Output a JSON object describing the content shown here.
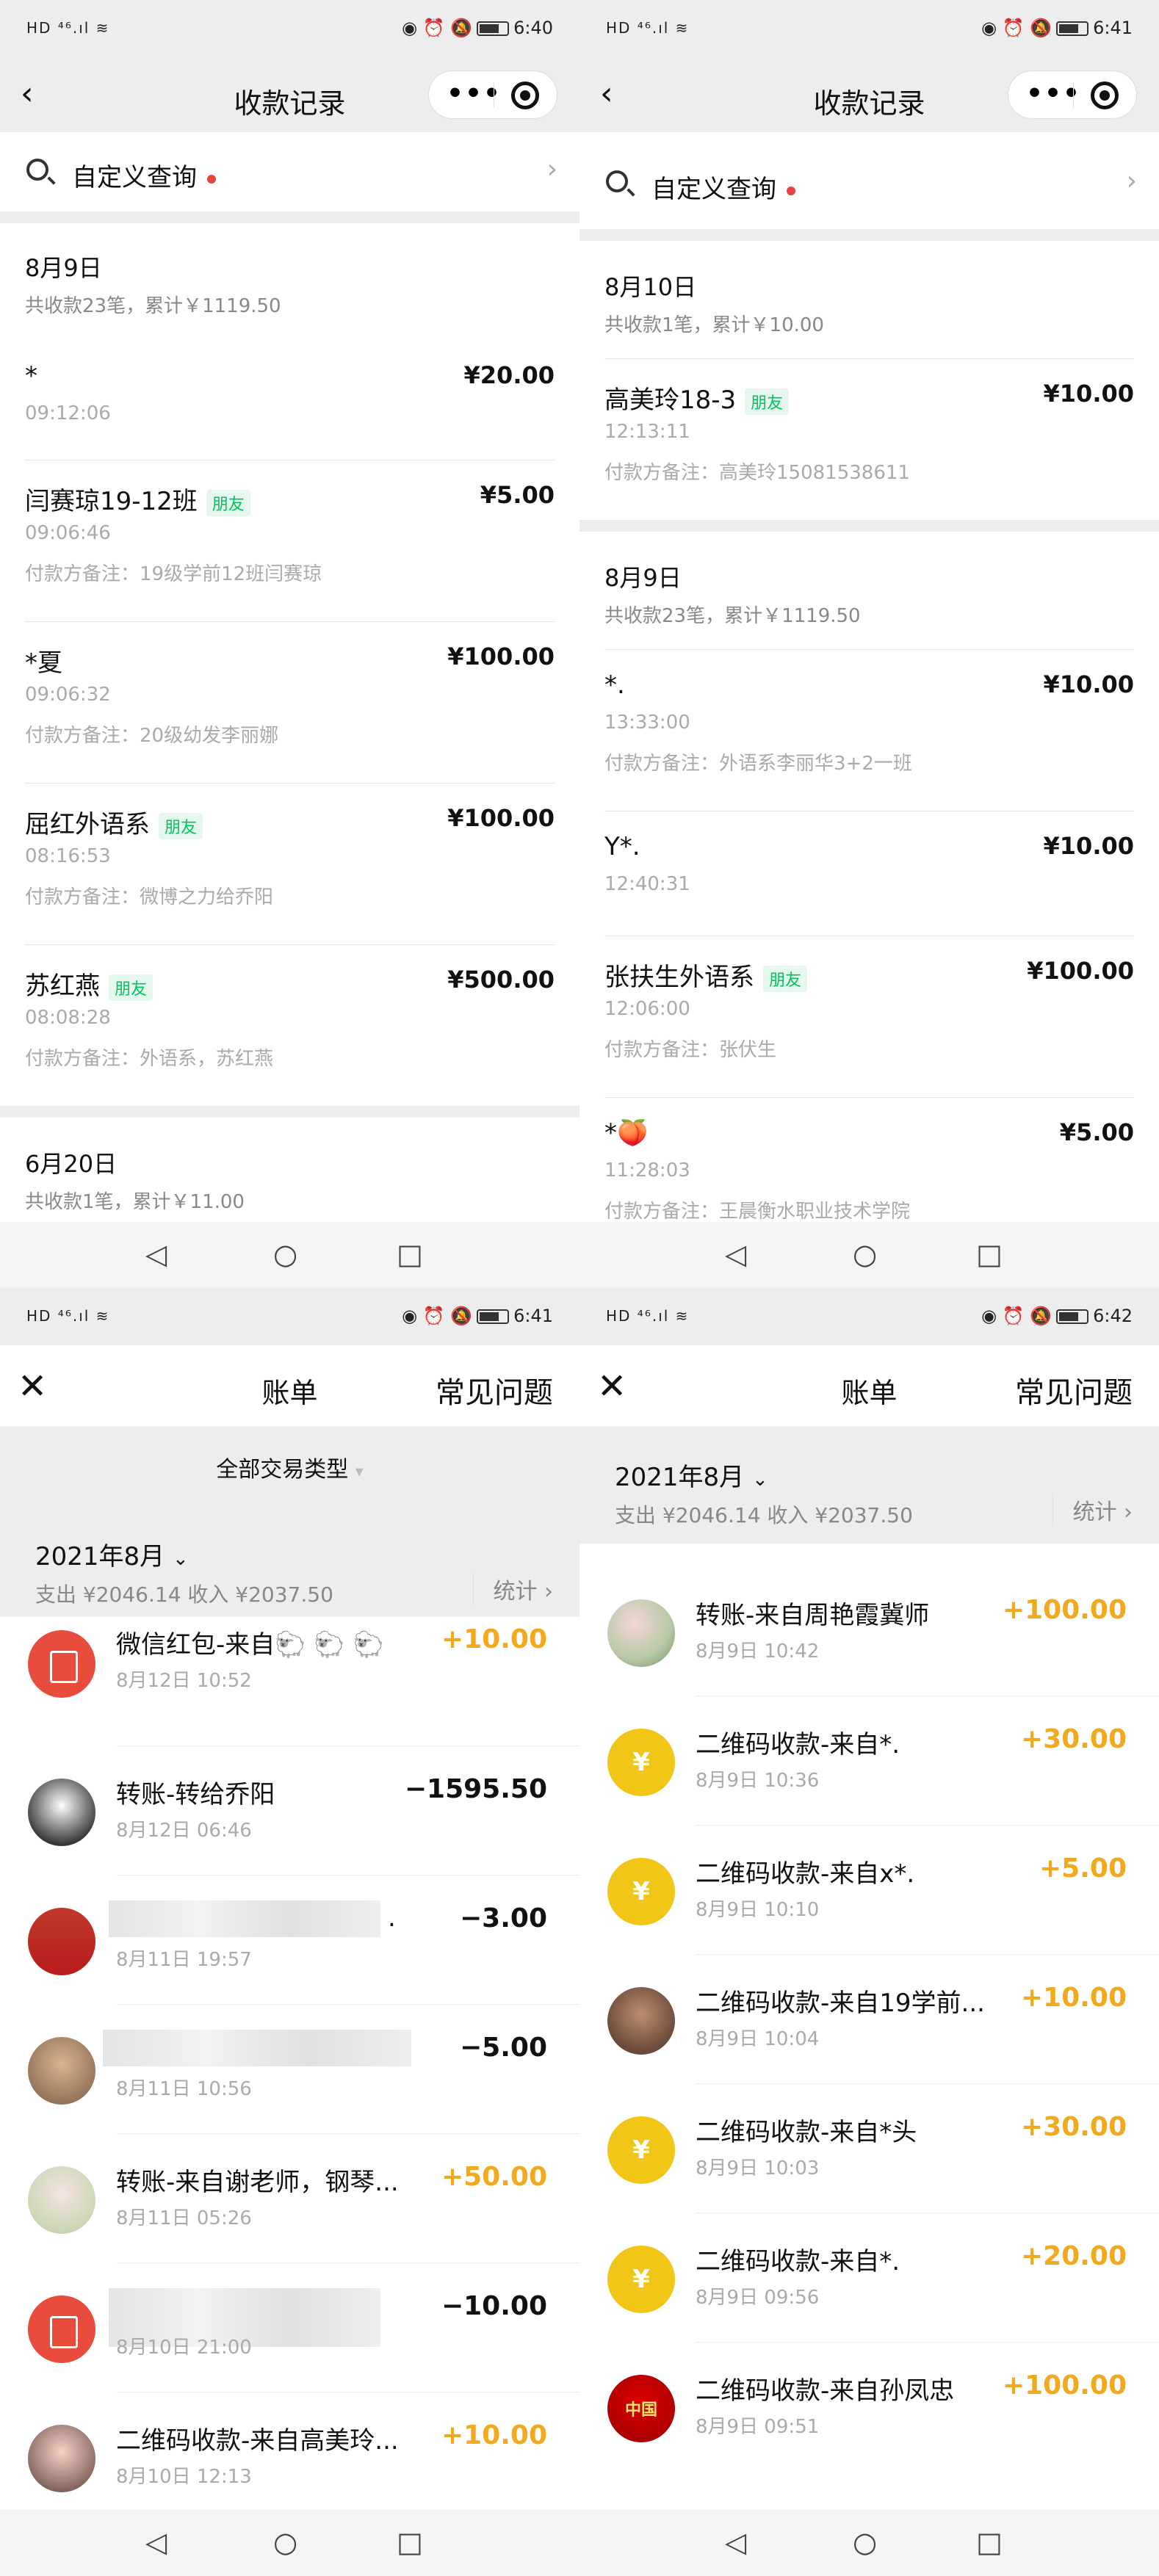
{
  "p1": {
    "status": {
      "left": "HD ⁴⁶.ıl ≋",
      "right_icons": "◉ ⏰ 🔕",
      "time": "6:40"
    },
    "title": "收款记录",
    "search": {
      "label": "自定义查询"
    },
    "day1": {
      "title": "8月9日",
      "summary": "共收款23笔，累计￥1119.50"
    },
    "records": [
      {
        "name": "*",
        "amount": "¥20.00",
        "time": "09:12:06",
        "note": ""
      },
      {
        "name": "闫赛琼19-12班",
        "badge": "朋友",
        "amount": "¥5.00",
        "time": "09:06:46",
        "note": "付款方备注：19级学前12班闫赛琼"
      },
      {
        "name": "*夏",
        "amount": "¥100.00",
        "time": "09:06:32",
        "note": "付款方备注：20级幼发李丽娜"
      },
      {
        "name": "屈红外语系",
        "badge": "朋友",
        "amount": "¥100.00",
        "time": "08:16:53",
        "note": "付款方备注：微博之力给乔阳"
      },
      {
        "name": "苏红燕",
        "badge": "朋友",
        "amount": "¥500.00",
        "time": "08:08:28",
        "note": "付款方备注：外语系，苏红燕"
      }
    ],
    "day2": {
      "title": "6月20日",
      "summary": "共收款1笔，累计￥11.00"
    }
  },
  "p2": {
    "status": {
      "left": "HD ⁴⁶.ıl ≋",
      "right_icons": "◉ ⏰ 🔕",
      "time": "6:41"
    },
    "title": "收款记录",
    "search": {
      "label": "自定义查询"
    },
    "day1": {
      "title": "8月10日",
      "summary": "共收款1笔，累计￥10.00"
    },
    "rec_a": {
      "name": "高美玲18-3",
      "badge": "朋友",
      "amount": "¥10.00",
      "time": "12:13:11",
      "note": "付款方备注：高美玲15081538611"
    },
    "day2": {
      "title": "8月9日",
      "summary": "共收款23笔，累计￥1119.50"
    },
    "records": [
      {
        "name": "*.",
        "amount": "¥10.00",
        "time": "13:33:00",
        "note": "付款方备注：外语系李丽华3+2一班"
      },
      {
        "name": "Y*.",
        "amount": "¥10.00",
        "time": "12:40:31",
        "note": ""
      },
      {
        "name": "张扶生外语系",
        "badge": "朋友",
        "amount": "¥100.00",
        "time": "12:06:00",
        "note": "付款方备注：张伏生"
      },
      {
        "name": "*🍑",
        "amount": "¥5.00",
        "time": "11:28:03",
        "note": "付款方备注：王晨衡水职业技术学院"
      }
    ]
  },
  "p3": {
    "status": {
      "left": "HD ⁴⁶.ıl ≋",
      "right_icons": "◉ ⏰ 🔕",
      "time": "6:41"
    },
    "title": "账单",
    "faq": "常见问题",
    "filter": "全部交易类型",
    "month": "2021年8月",
    "summary": "支出 ¥2046.14 收入 ¥2037.50",
    "stat": "统计",
    "items": [
      {
        "title": "微信红包-来自🐑 🐑 🐑",
        "date": "8月12日 10:52",
        "amount": "+10.00",
        "kind": "inc"
      },
      {
        "title": "转账-转给乔阳",
        "date": "8月12日 06:46",
        "amount": "−1595.50",
        "kind": "exp"
      },
      {
        "title": ".",
        "date": "8月11日 19:57",
        "amount": "−3.00",
        "kind": "exp"
      },
      {
        "title": "",
        "date": "8月11日 10:56",
        "amount": "−5.00",
        "kind": "exp"
      },
      {
        "title": "转账-来自谢老师，钢琴...",
        "date": "8月11日 05:26",
        "amount": "+50.00",
        "kind": "inc"
      },
      {
        "title": "",
        "date": "8月10日 21:00",
        "amount": "−10.00",
        "kind": "exp"
      },
      {
        "title": "二维码收款-来自高美玲...",
        "date": "8月10日 12:13",
        "amount": "+10.00",
        "kind": "inc"
      }
    ]
  },
  "p4": {
    "status": {
      "left": "HD ⁴⁶.ıl ≋",
      "right_icons": "◉ ⏰ 🔕",
      "time": "6:42"
    },
    "title": "账单",
    "faq": "常见问题",
    "month": "2021年8月",
    "summary": "支出 ¥2046.14 收入 ¥2037.50",
    "stat": "统计",
    "items": [
      {
        "title": "转账-来自周艳霞冀师",
        "date": "8月9日 10:42",
        "amount": "+100.00"
      },
      {
        "title": "二维码收款-来自*.",
        "date": "8月9日 10:36",
        "amount": "+30.00"
      },
      {
        "title": "二维码收款-来自x*.",
        "date": "8月9日 10:10",
        "amount": "+5.00"
      },
      {
        "title": "二维码收款-来自19学前...",
        "date": "8月9日 10:04",
        "amount": "+10.00"
      },
      {
        "title": "二维码收款-来自*头",
        "date": "8月9日 10:03",
        "amount": "+30.00"
      },
      {
        "title": "二维码收款-来自*.",
        "date": "8月9日 09:56",
        "amount": "+20.00"
      },
      {
        "title": "二维码收款-来自孙凤忠",
        "date": "8月9日 09:51",
        "amount": "+100.00"
      }
    ]
  },
  "sysnav": {
    "back": "◁",
    "home": "○",
    "recent": "□"
  }
}
